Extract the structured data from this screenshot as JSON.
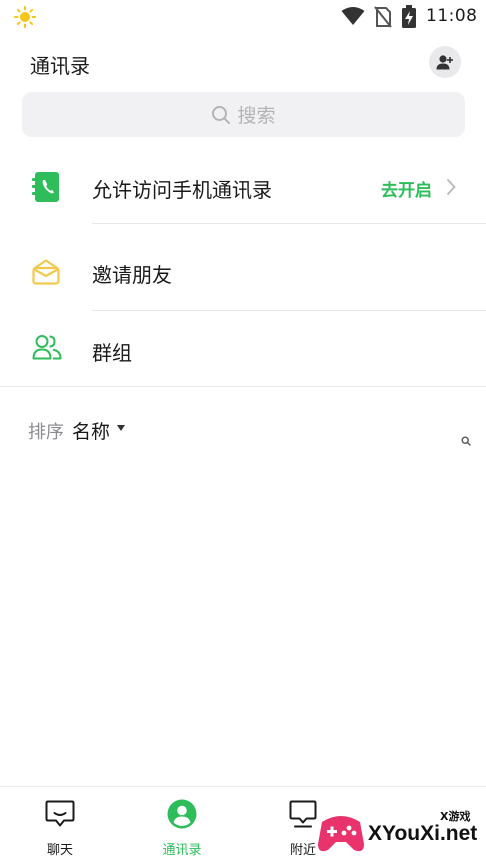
{
  "status_bar": {
    "time": "11:08",
    "icons": [
      "sun-icon",
      "wifi-icon",
      "no-sim-icon",
      "battery-charging-icon"
    ]
  },
  "header": {
    "title": "通讯录",
    "add_friend_icon": "add-user-icon"
  },
  "search": {
    "placeholder": "搜索",
    "icon": "search-icon"
  },
  "entries": [
    {
      "label": "允许访问手机通讯录",
      "action": "去开启",
      "icon": "phone-book-icon"
    },
    {
      "label": "邀请朋友",
      "icon": "envelope-icon"
    },
    {
      "label": "群组",
      "icon": "group-icon"
    }
  ],
  "sort": {
    "label": "排序",
    "value": "名称"
  },
  "bottom_nav": [
    {
      "label": "聊天",
      "icon": "chat-bubble-icon",
      "active": false
    },
    {
      "label": "通讯录",
      "icon": "contacts-icon",
      "active": true
    },
    {
      "label": "附近",
      "icon": "nearby-icon",
      "active": false
    }
  ],
  "watermark": {
    "text": "XYouXi.net",
    "small_text": "X游戏"
  },
  "colors": {
    "accent": "#2fbd5b",
    "envelope": "#f2c94c",
    "muted": "#8c8c90",
    "search_bg": "#f1f1f3"
  }
}
